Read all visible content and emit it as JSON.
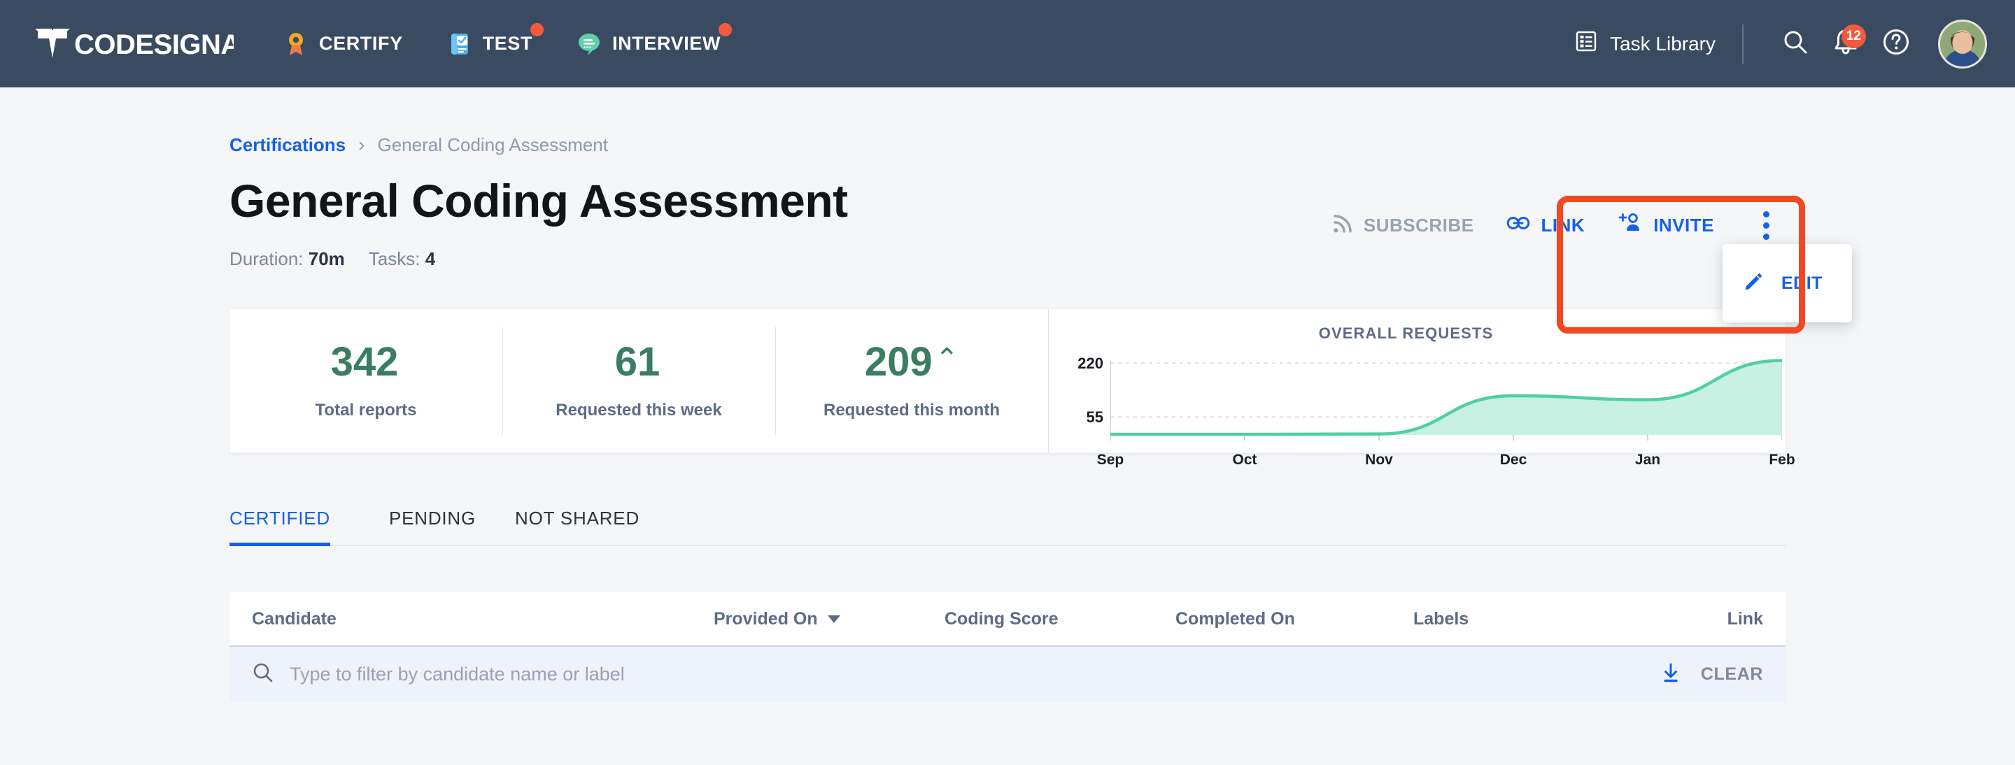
{
  "topnav": {
    "logo_text": "CODESIGNAL",
    "items": [
      {
        "label": "CERTIFY",
        "icon": "medal-icon",
        "badge": false
      },
      {
        "label": "TEST",
        "icon": "checklist-icon",
        "badge": true
      },
      {
        "label": "INTERVIEW",
        "icon": "speech-bubble-icon",
        "badge": true
      }
    ],
    "task_library": "Task Library",
    "notifications_count": "12",
    "icons": {
      "task_library": "list-icon",
      "search": "search-icon",
      "bell": "bell-icon",
      "help": "question-circle-icon",
      "avatar": "user-avatar"
    }
  },
  "breadcrumb": {
    "root": "Certifications",
    "separator": "›",
    "current": "General Coding Assessment"
  },
  "page": {
    "title": "General Coding Assessment",
    "duration_label": "Duration:",
    "duration_value": "70m",
    "tasks_label": "Tasks:",
    "tasks_value": "4"
  },
  "actions": {
    "subscribe": "SUBSCRIBE",
    "link": "LINK",
    "invite": "INVITE",
    "menu": {
      "edit": "EDIT"
    }
  },
  "stats": [
    {
      "value": "342",
      "suffix": "",
      "label": "Total reports"
    },
    {
      "value": "61",
      "suffix": "",
      "label": "Requested this week"
    },
    {
      "value": "209",
      "suffix": "⌃",
      "label": "Requested this month"
    }
  ],
  "chart_data": {
    "type": "area",
    "title": "OVERALL REQUESTS",
    "xlabel": "",
    "ylabel": "",
    "categories": [
      "Sep",
      "Oct",
      "Nov",
      "Dec",
      "Jan",
      "Feb"
    ],
    "x": [
      "Sep",
      "Oct",
      "Nov",
      "Dec",
      "Jan",
      "Feb"
    ],
    "values": [
      2,
      2,
      3,
      120,
      108,
      228
    ],
    "ytick_labels": [
      "220",
      "55"
    ],
    "ytick_values": [
      220,
      55
    ],
    "ylim": [
      0,
      240
    ],
    "grid": true,
    "legend": "none",
    "line_color": "#4ecfa6",
    "fill_color": "#c8f0e3"
  },
  "tabs": [
    {
      "label": "CERTIFIED",
      "active": true
    },
    {
      "label": "PENDING",
      "active": false
    },
    {
      "label": "NOT SHARED",
      "active": false
    }
  ],
  "table": {
    "columns": [
      "Candidate",
      "Provided On",
      "Coding Score",
      "Completed On",
      "Labels",
      "Link"
    ],
    "sorted_column": "Provided On",
    "filter_placeholder": "Type to filter by candidate name or label",
    "filter_value": "",
    "download_icon": "download-icon",
    "search_icon": "search-icon",
    "clear_label": "CLEAR"
  },
  "colors": {
    "nav_bg": "#3a4b61",
    "accent_blue": "#1660e8",
    "badge_orange": "#ef5b3c",
    "stat_green": "#3a7d63",
    "annotation_red": "#ef4823",
    "page_bg": "#f4f6f8"
  }
}
